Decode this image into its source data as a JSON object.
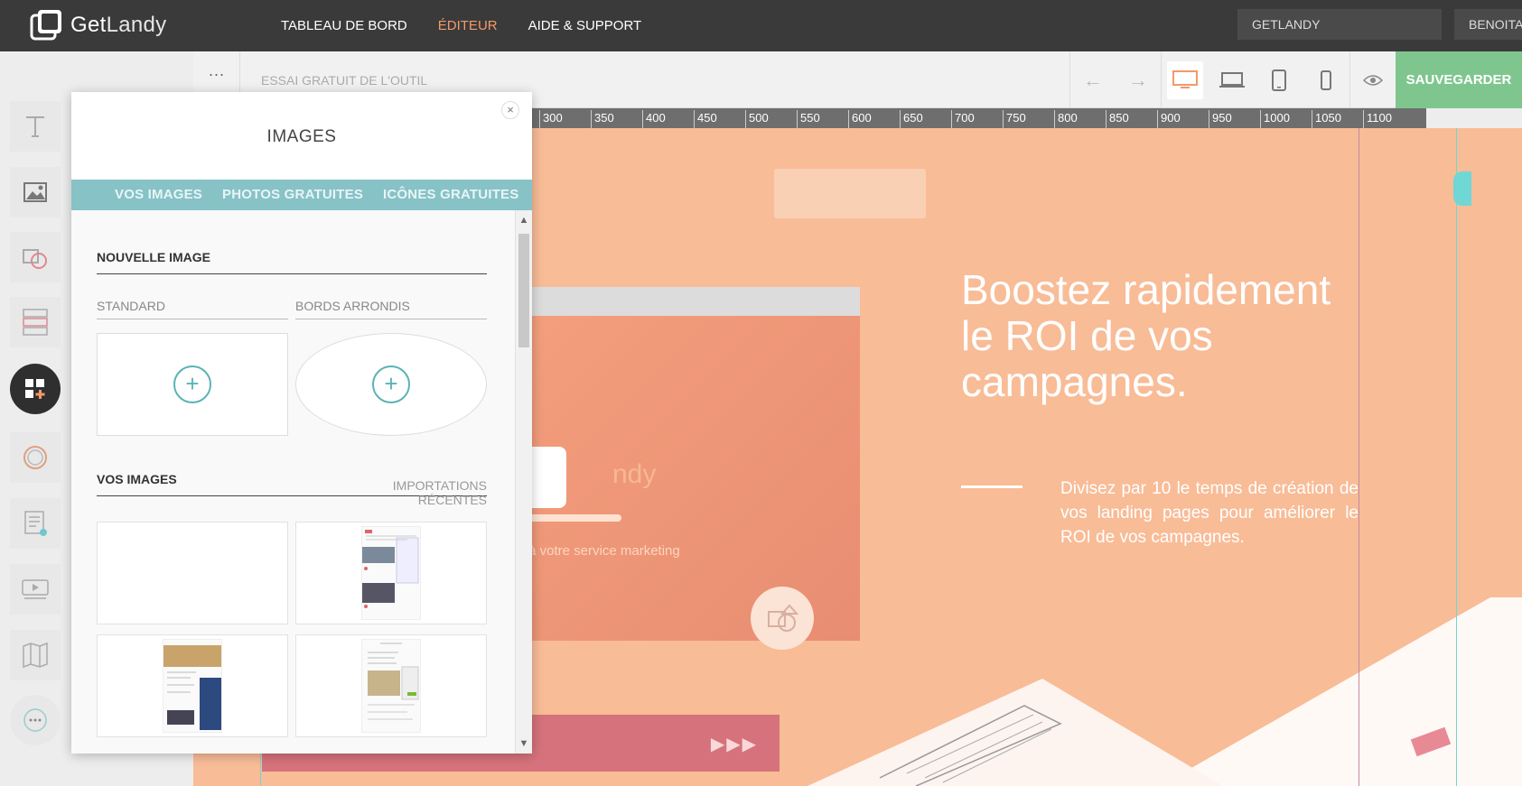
{
  "topbar": {
    "logo_part1": "Get",
    "logo_part2": "Landy",
    "nav": [
      "TABLEAU DE BORD",
      "ÉDITEUR",
      "AIDE & SUPPORT"
    ],
    "nav_active": "ÉDITEUR",
    "project_value": "GETLANDY",
    "user_label": "BENOITA"
  },
  "toolbar": {
    "menu_dots": "···",
    "page_title": "ESSAI GRATUIT DE L'OUTIL",
    "save_label": "SAUVEGARDER",
    "undo_icon": "←",
    "redo_icon": "→"
  },
  "ruler": {
    "ticks": [
      "300",
      "350",
      "400",
      "450",
      "500",
      "550",
      "600",
      "650",
      "700",
      "750",
      "800",
      "850",
      "900",
      "950",
      "1000",
      "1050",
      "1100"
    ]
  },
  "panel": {
    "title": "IMAGES",
    "close": "×",
    "tabs": [
      "VOS IMAGES",
      "PHOTOS GRATUITES",
      "ICÔNES GRATUITES"
    ],
    "new_image_heading": "NOUVELLE IMAGE",
    "standard_label": "STANDARD",
    "rounded_label": "BORDS ARRONDIS",
    "add_symbol": "+",
    "your_images_heading": "VOS IMAGES",
    "recent_imports": "IMPORTATIONS RÉCENTES"
  },
  "canvas": {
    "headline": "Boostez rapidement le ROI de vos campagnes.",
    "subtext": "Divisez par 10 le temps de création de vos landing pages pour améliorer le ROI de vos campagnes.",
    "ghost_logo": "ndy",
    "ghost_tagline": "r à votre service marketing",
    "arrows": "▶▶▶"
  },
  "colors": {
    "accent": "#f29a6a",
    "save": "#7fc68e",
    "teal": "#87c2c7",
    "canvas_bg": "#f8bc97"
  }
}
